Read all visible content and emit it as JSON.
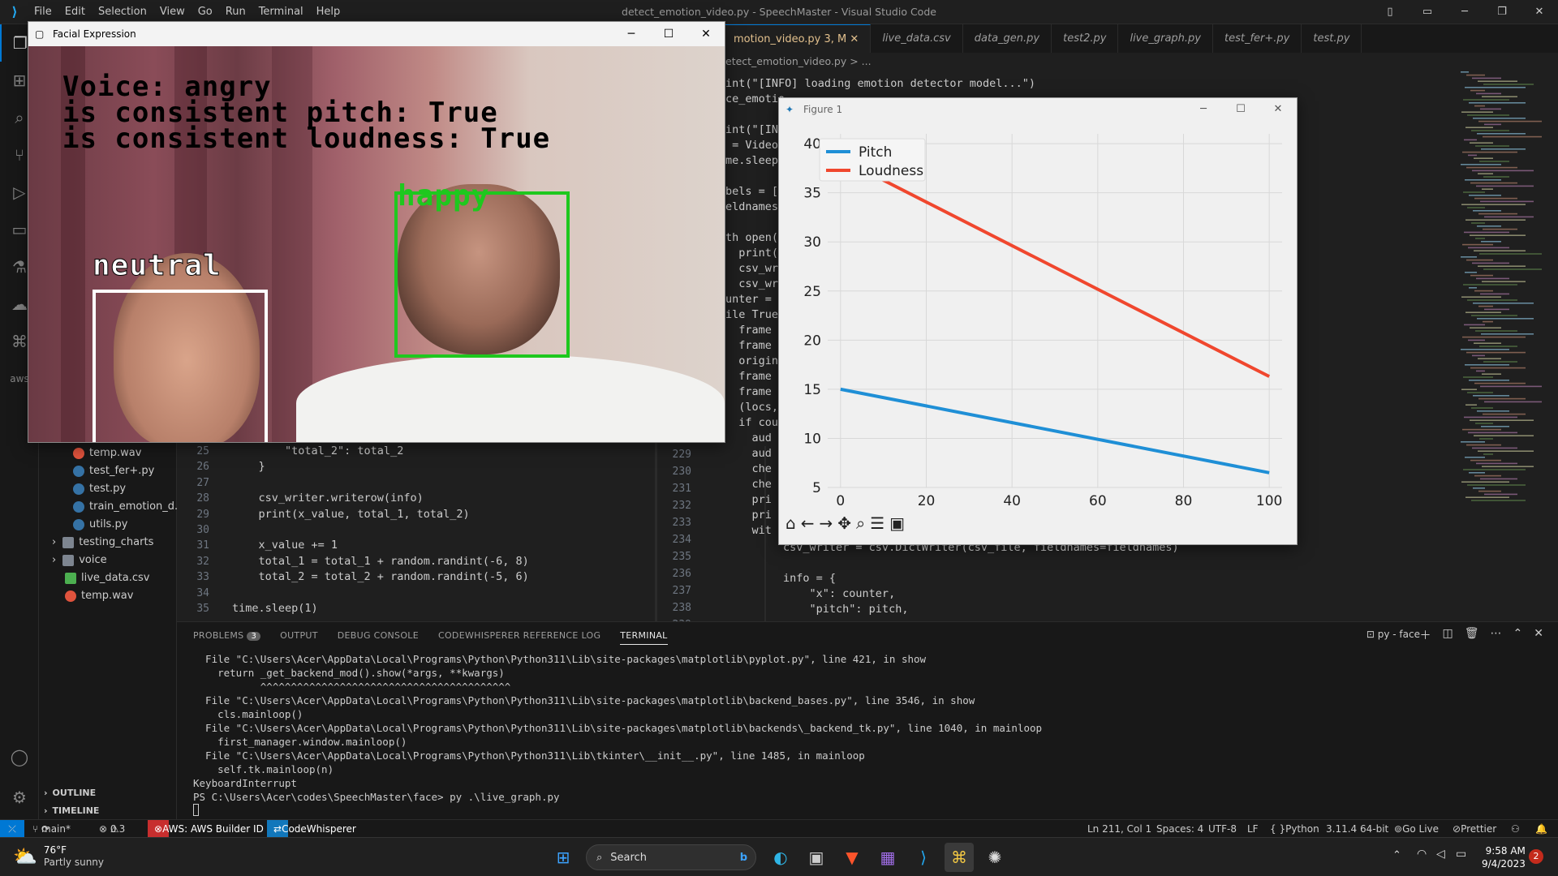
{
  "window": {
    "title": "detect_emotion_video.py - SpeechMaster - Visual Studio Code",
    "menu": [
      "File",
      "Edit",
      "Selection",
      "View",
      "Go",
      "Run",
      "Terminal",
      "Help"
    ]
  },
  "tabs": [
    {
      "label": "motion_video.py 3, M",
      "active": true
    },
    {
      "label": "live_data.csv"
    },
    {
      "label": "data_gen.py"
    },
    {
      "label": "test2.py"
    },
    {
      "label": "live_graph.py"
    },
    {
      "label": "test_fer+.py"
    },
    {
      "label": "test.py"
    }
  ],
  "breadcrumb": "etect_emotion_video.py > ...",
  "explorer": {
    "items": [
      {
        "label": "temp.wav",
        "type": "audio"
      },
      {
        "label": "test_fer+.py",
        "type": "py"
      },
      {
        "label": "test.py",
        "type": "py"
      },
      {
        "label": "train_emotion_d...",
        "type": "py"
      },
      {
        "label": "utils.py",
        "type": "py"
      },
      {
        "label": "testing_charts",
        "type": "folder"
      },
      {
        "label": "voice",
        "type": "folder"
      },
      {
        "label": "live_data.csv",
        "type": "csv"
      },
      {
        "label": "temp.wav",
        "type": "audio"
      }
    ],
    "outline": "OUTLINE",
    "timeline": "TIMELINE"
  },
  "left_editor": {
    "lines": [
      {
        "n": "25",
        "text": "        \"total_2\": total_2"
      },
      {
        "n": "26",
        "text": "    }"
      },
      {
        "n": "27",
        "text": ""
      },
      {
        "n": "28",
        "text": "    csv_writer.writerow(info)"
      },
      {
        "n": "29",
        "text": "    print(x_value, total_1, total_2)"
      },
      {
        "n": "30",
        "text": ""
      },
      {
        "n": "31",
        "text": "    x_value += 1"
      },
      {
        "n": "32",
        "text": "    total_1 = total_1 + random.randint(-6, 8)"
      },
      {
        "n": "33",
        "text": "    total_2 = total_2 + random.randint(-5, 6)"
      },
      {
        "n": "34",
        "text": ""
      },
      {
        "n": "35",
        "text": "time.sleep(1)"
      }
    ]
  },
  "right_editor": {
    "top_lines": [
      "int(\"[INFO] loading emotion detector model...\")",
      "ce_emotio",
      "",
      "int(\"[INF",
      " = VideoS",
      "me.sleep(",
      "",
      "bels = [\"",
      "eldnames",
      "",
      "th open('",
      "  print(\"",
      "  csv_wri",
      "  csv_wri",
      "unter = 0",
      "ile True:",
      "  frame =",
      "  frame =",
      "  origina",
      "  frame =",
      "  frame =",
      "  (locs,",
      "  if coun",
      "    aud",
      "    aud",
      "    che",
      "    che",
      "    pri",
      "    pri",
      "    wit"
    ],
    "numbers": [
      "229",
      "230",
      "231",
      "232",
      "233",
      "234",
      "235",
      "236",
      "237",
      "238",
      "239"
    ],
    "lower_lines": [
      "        csv_writer = csv.DictWriter(csv_file, fieldnames=fieldnames)",
      "",
      "        info = {",
      "            \"x\": counter,",
      "            \"pitch\": pitch,"
    ]
  },
  "face_window": {
    "title": "Facial Expression",
    "line1": "Voice: angry",
    "line2": "is consistent pitch: True",
    "line3": "is consistent loudness: True",
    "face1_label": "neutral",
    "face2_label": "happy"
  },
  "figure_window": {
    "title": "Figure 1"
  },
  "chart_data": {
    "type": "line",
    "x": [
      0,
      100
    ],
    "series": [
      {
        "name": "Pitch",
        "values": [
          15,
          6.5
        ],
        "color": "#1f8fd6"
      },
      {
        "name": "Loudness",
        "values": [
          38.5,
          16.3
        ],
        "color": "#f0472e"
      }
    ],
    "xticks": [
      "0",
      "20",
      "40",
      "60",
      "80",
      "100"
    ],
    "yticks": [
      "5",
      "10",
      "15",
      "20",
      "25",
      "30",
      "35",
      "40"
    ],
    "xlim": [
      -3,
      103
    ],
    "ylim": [
      5,
      41
    ],
    "grid": true,
    "legend": "top-left"
  },
  "panel": {
    "tabs": [
      "PROBLEMS",
      "OUTPUT",
      "DEBUG CONSOLE",
      "CODEWHISPERER REFERENCE LOG",
      "TERMINAL"
    ],
    "problems_count": "3",
    "terminal_name": "py - face",
    "lines": [
      "  File \"C:\\Users\\Acer\\AppData\\Local\\Programs\\Python\\Python311\\Lib\\site-packages\\matplotlib\\pyplot.py\", line 421, in show",
      "    return _get_backend_mod().show(*args, **kwargs)",
      "           ^^^^^^^^^^^^^^^^^^^^^^^^^^^^^^^^^^^^^^^^^",
      "  File \"C:\\Users\\Acer\\AppData\\Local\\Programs\\Python\\Python311\\Lib\\site-packages\\matplotlib\\backend_bases.py\", line 3546, in show",
      "    cls.mainloop()",
      "  File \"C:\\Users\\Acer\\AppData\\Local\\Programs\\Python\\Python311\\Lib\\site-packages\\matplotlib\\backends\\_backend_tk.py\", line 1040, in mainloop",
      "    first_manager.window.mainloop()",
      "  File \"C:\\Users\\Acer\\AppData\\Local\\Programs\\Python\\Python311\\Lib\\tkinter\\__init__.py\", line 1485, in mainloop",
      "    self.tk.mainloop(n)",
      "KeyboardInterrupt",
      "PS C:\\Users\\Acer\\codes\\SpeechMaster\\face> py .\\live_graph.py"
    ]
  },
  "status": {
    "branch": "main*",
    "errors": "0",
    "warnings": "3",
    "aws": "AWS: AWS Builder ID",
    "codewhisperer": "CodeWhisperer",
    "position": "Ln 211, Col 1",
    "spaces": "Spaces: 4",
    "encoding": "UTF-8",
    "eol": "LF",
    "language": "Python",
    "interpreter": "3.11.4 64-bit",
    "golive": "Go Live",
    "prettier": "Prettier"
  },
  "taskbar": {
    "weather_temp": "76°F",
    "weather_desc": "Partly sunny",
    "search_placeholder": "Search",
    "time": "9:58 AM",
    "date": "9/4/2023",
    "notifications": "2"
  }
}
